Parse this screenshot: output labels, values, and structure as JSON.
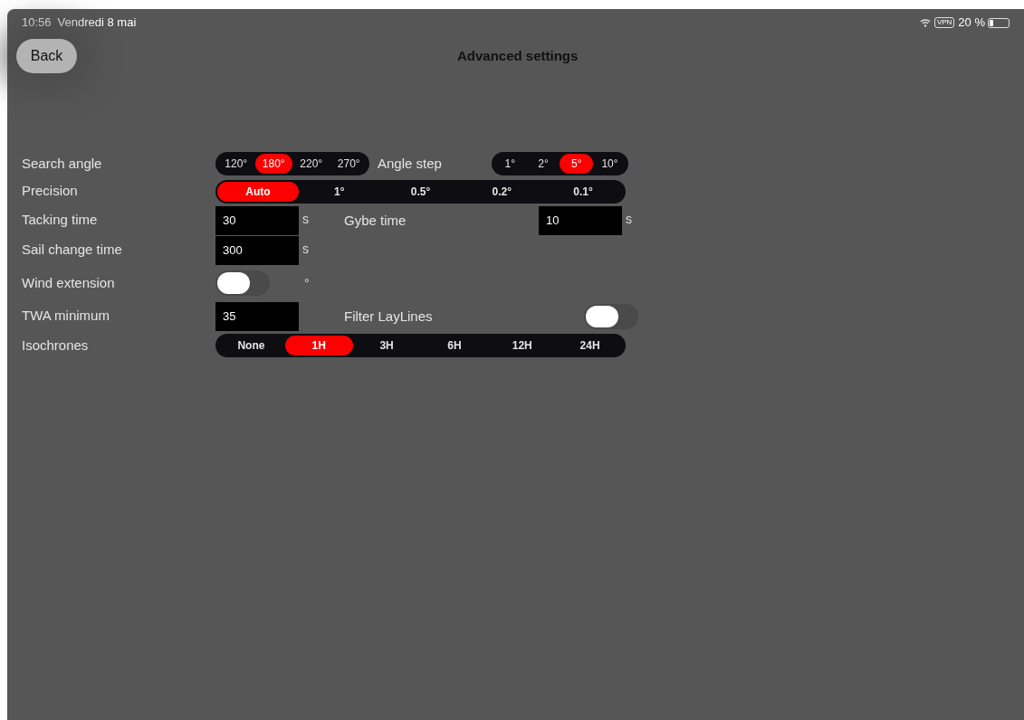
{
  "status_bar": {
    "time": "10:56",
    "date": "Vendredi 8 mai",
    "vpn": "VPN",
    "battery": "20 %"
  },
  "nav": {
    "back": "Back",
    "title": "Advanced settings"
  },
  "rows": [
    {
      "kind": "segments",
      "label": "Search angle",
      "options": [
        {
          "label": "120°",
          "selected": false
        },
        {
          "label": "180°",
          "selected": true
        },
        {
          "label": "220°",
          "selected": false
        },
        {
          "label": "270°",
          "selected": false
        }
      ],
      "second": {
        "kind": "segments",
        "label": "Angle step",
        "options": [
          {
            "label": "1°",
            "selected": false
          },
          {
            "label": "2°",
            "selected": false
          },
          {
            "label": "5°",
            "selected": true
          },
          {
            "label": "10°",
            "selected": false
          }
        ]
      }
    },
    {
      "kind": "wide_segments",
      "label": "Precision",
      "options": [
        {
          "label": "Auto",
          "selected": true
        },
        {
          "label": "1°",
          "selected": false
        },
        {
          "label": "0.5°",
          "selected": false
        },
        {
          "label": "0.2°",
          "selected": false
        },
        {
          "label": "0.1°",
          "selected": false
        }
      ]
    },
    {
      "kind": "input",
      "label": "Tacking time",
      "value": "30",
      "unit": "s",
      "second": {
        "kind": "input",
        "label": "Gybe time",
        "value": "10",
        "unit": "s"
      }
    },
    {
      "kind": "input",
      "label": "Sail change time",
      "value": "300",
      "unit": "s"
    },
    {
      "kind": "toggle",
      "label": "Wind extension",
      "on": false,
      "unit": "°"
    },
    {
      "kind": "input",
      "label": "TWA minimum",
      "value": "35",
      "second": {
        "kind": "toggle",
        "label": "Filter LayLines",
        "on": false
      }
    },
    {
      "kind": "wide_segments",
      "label": "Isochrones",
      "options": [
        {
          "label": "None",
          "selected": false
        },
        {
          "label": "1H",
          "selected": true
        },
        {
          "label": "3H",
          "selected": false
        },
        {
          "label": "6H",
          "selected": false
        },
        {
          "label": "12H",
          "selected": false
        },
        {
          "label": "24H",
          "selected": false
        }
      ]
    }
  ]
}
